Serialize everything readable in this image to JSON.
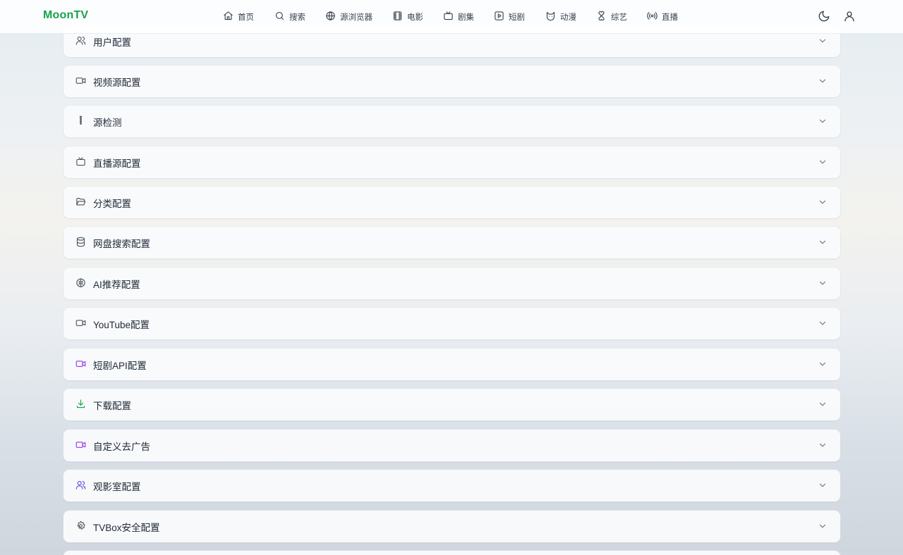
{
  "header": {
    "brand": "MoonTV",
    "nav": [
      {
        "label": "首页",
        "icon": "home-icon"
      },
      {
        "label": "搜索",
        "icon": "search-icon"
      },
      {
        "label": "源浏览器",
        "icon": "globe-icon"
      },
      {
        "label": "电影",
        "icon": "film-icon"
      },
      {
        "label": "剧集",
        "icon": "tv-icon"
      },
      {
        "label": "短剧",
        "icon": "play-square-icon"
      },
      {
        "label": "动漫",
        "icon": "cat-icon"
      },
      {
        "label": "综艺",
        "icon": "clover-icon"
      },
      {
        "label": "直播",
        "icon": "radio-icon"
      }
    ],
    "actions": [
      {
        "icon": "moon-icon"
      },
      {
        "icon": "user-icon"
      }
    ]
  },
  "panels": [
    {
      "label": "用户配置",
      "icon": "users-icon",
      "color": "#4b5563"
    },
    {
      "label": "视频源配置",
      "icon": "video-icon",
      "color": "#4b5563"
    },
    {
      "label": "源检测",
      "icon": "test-tube-icon",
      "color": "#4b5563"
    },
    {
      "label": "直播源配置",
      "icon": "tv-icon",
      "color": "#4b5563"
    },
    {
      "label": "分类配置",
      "icon": "folder-open-icon",
      "color": "#4b5563"
    },
    {
      "label": "网盘搜索配置",
      "icon": "database-icon",
      "color": "#4b5563"
    },
    {
      "label": "AI推荐配置",
      "icon": "brain-icon",
      "color": "#4b5563"
    },
    {
      "label": "YouTube配置",
      "icon": "video-icon",
      "color": "#4b5563"
    },
    {
      "label": "短剧API配置",
      "icon": "video-icon",
      "color": "#9333ea"
    },
    {
      "label": "下载配置",
      "icon": "download-icon",
      "color": "#16a34a"
    },
    {
      "label": "自定义去广告",
      "icon": "video-icon",
      "color": "#9333ea"
    },
    {
      "label": "观影室配置",
      "icon": "users-icon",
      "color": "#4f46e5"
    },
    {
      "label": "TVBox安全配置",
      "icon": "settings-icon",
      "color": "#4b5563"
    }
  ],
  "colors": {
    "brand": "#16a34a",
    "panel_bg": "#f9fafb",
    "text": "#1f2937"
  }
}
